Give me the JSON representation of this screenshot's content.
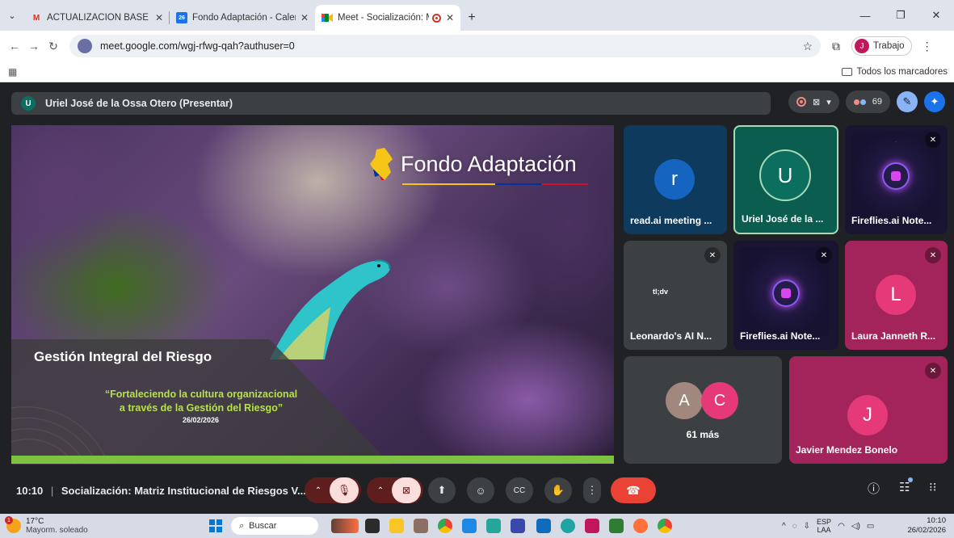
{
  "browser": {
    "tabs": [
      {
        "title": "ACTUALIZACIÓN BASE SUBGER",
        "icon": "gmail-icon"
      },
      {
        "title": "Fondo Adaptación - Calendar -",
        "icon": "calendar-icon"
      },
      {
        "title": "Meet - Socialización: Matriz",
        "icon": "meet-icon",
        "active": true
      }
    ],
    "url": "meet.google.com/wgj-rfwg-qah?authuser=0",
    "profile_label": "Trabajo",
    "profile_initial": "J",
    "bookmarks_label": "Todos los marcadores"
  },
  "meet": {
    "presenter_initial": "U",
    "presenter_label": "Uriel José de la Ossa Otero (Presentar)",
    "participants_count": "69",
    "slide": {
      "logo_text": "Fondo Adaptación",
      "title": "Gestión Integral del Riesgo",
      "quote_line1": "“Fortaleciendo la cultura organizacional",
      "quote_line2": "a través de la Gestión del Riesgo”",
      "date": "26/02/2026"
    },
    "tiles": [
      {
        "name": "read.ai meeting ...",
        "initial": "r"
      },
      {
        "name": "Uriel José de la ...",
        "initial": "U"
      },
      {
        "name": "Fireflies.ai Note...",
        "initial": ""
      },
      {
        "name": "Leonardo's AI N...",
        "initial": ""
      },
      {
        "name": "Fireflies.ai Note...",
        "initial": ""
      },
      {
        "name": "Laura Janneth R...",
        "initial": "L"
      },
      {
        "name": "61 más",
        "initial": "A",
        "initial2": "C"
      },
      {
        "name": "Javier Mendez Bonelo",
        "initial": "J"
      }
    ],
    "tldv_logo": "tl;dv",
    "meeting_time": "10:10",
    "meeting_title": "Socialización: Matriz Institucional de Riesgos V..."
  },
  "taskbar": {
    "temp": "17°C",
    "weather": "Mayorm. soleado",
    "weather_badge": "1",
    "search_placeholder": "Buscar",
    "lang": "ESP",
    "lang2": "LAA",
    "time": "10:10",
    "date": "26/02/2026"
  },
  "colors": {
    "meet_bg": "#202124",
    "tile_blue": "#0e3a5e",
    "tile_teal": "#0b5d4f",
    "tile_magenta": "#a3245a",
    "end_call": "#ea4335",
    "slide_green": "#7dc243"
  }
}
